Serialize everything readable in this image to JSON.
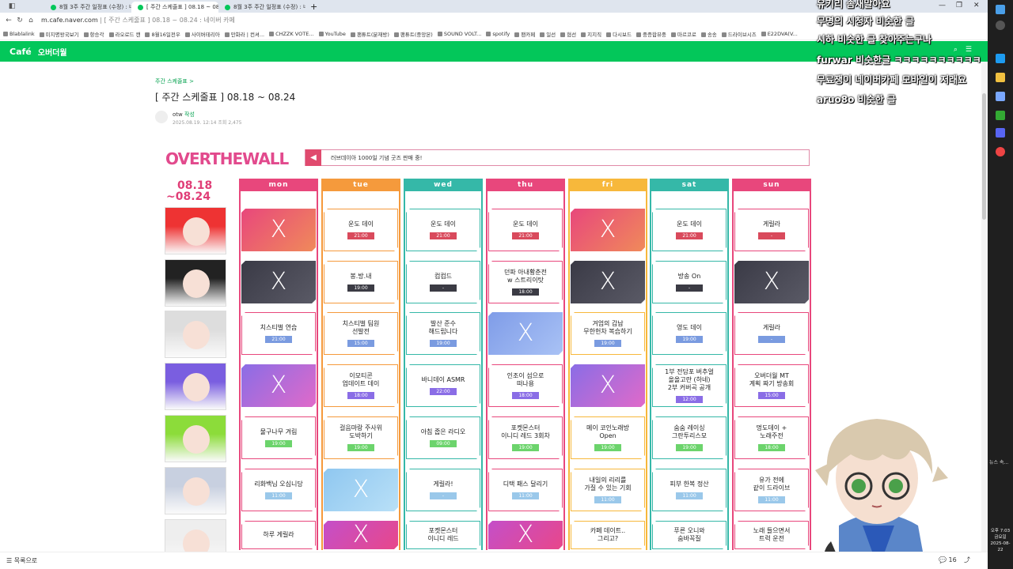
{
  "tabs": [
    {
      "label": "8월 3주 주간 일정표 (수정) : 네"
    },
    {
      "label": "[ 주간 스케줄표 ] 08.18 ~ 08.24"
    },
    {
      "label": "8월 3주 주간 일정표 (수정) : 네이"
    }
  ],
  "address": {
    "host": "m.cafe.naver.com",
    "path": "| [ 주간 스케줄표 ] 08.18 ~ 08.24 : 네이버 카페"
  },
  "bookmarks": [
    "Blablalink",
    "미지명왕국보기",
    "항승각",
    "라오로드 캔",
    "8월16일전우",
    "사이버테리아",
    "만화라 | 컨셔...",
    "CHZZK VOTE...",
    "YouTube",
    "팬튜트(분재방)",
    "팬튜트(중앙본)",
    "SOUND VOLT...",
    "spotify",
    "팬카페",
    "일선",
    "협선",
    "지지직",
    "다시보드",
    "중증합뷰중",
    "마르코로",
    "송송",
    "드라이브시즈",
    "E22DVA(V..."
  ],
  "cafe": {
    "logo": "Café",
    "nick": "오버더월"
  },
  "post": {
    "board": "주간 스케줄표 >",
    "title": "[ 주간 스케줄표 ] 08.18 ~ 08.24",
    "author": "otw",
    "author_badge": "작성",
    "meta": "2025.08.19. 12:14  조회 2,475"
  },
  "banner": {
    "logo": "OVERTHEWALL",
    "dates_top": "08.18",
    "dates_bottom": "~08.24",
    "notice": "러브데이아 1000일 기념 굿즈 판매 중!"
  },
  "days": [
    {
      "name": "mon",
      "color": "#e8477c"
    },
    {
      "name": "tue",
      "color": "#f59a3c"
    },
    {
      "name": "wed",
      "color": "#35b8a8"
    },
    {
      "name": "thu",
      "color": "#e8477c"
    },
    {
      "name": "fri",
      "color": "#f7b83b"
    },
    {
      "name": "sat",
      "color": "#35b8a8"
    },
    {
      "name": "sun",
      "color": "#e8477c"
    }
  ],
  "rows": [
    [
      {
        "x": true,
        "g": "pink"
      },
      {
        "t": "운도 데이",
        "tm": "21:00"
      },
      {
        "t": "운도 데이",
        "tm": "21:00"
      },
      {
        "t": "운도 데이",
        "tm": "21:00"
      },
      {
        "x": true,
        "g": "pink"
      },
      {
        "t": "운도 데이",
        "tm": "21:00"
      },
      {
        "t": "게릴라",
        "tm": "-"
      }
    ],
    [
      {
        "x": true,
        "g": "dark"
      },
      {
        "t": "봉.방.내",
        "tm": "19:00"
      },
      {
        "t": "컴컴드",
        "tm": "-"
      },
      {
        "t": "던파 아내황춘전\nw 스트리이탓",
        "tm": "18:00"
      },
      {
        "x": true,
        "g": "dark"
      },
      {
        "t": "방송 On",
        "tm": "-"
      },
      {
        "x": true,
        "g": "dark"
      }
    ],
    [
      {
        "t": "치스티벌 연습",
        "tm": "21:00"
      },
      {
        "t": "치스티벌 팀원\n선발전",
        "tm": "15:00"
      },
      {
        "t": "발산 준수\n해드립니다",
        "tm": "19:00"
      },
      {
        "x": true,
        "g": "blue"
      },
      {
        "t": "겨엄의 갑납\n무한헌차 복습하기",
        "tm": "19:00"
      },
      {
        "t": "영도 데이",
        "tm": "19:00"
      },
      {
        "t": "게릴라",
        "tm": "-"
      }
    ],
    [
      {
        "x": true,
        "g": "purple"
      },
      {
        "t": "이모티콘\n업데이트 데이",
        "tm": "18:00"
      },
      {
        "t": "바니데이 ASMR",
        "tm": "22:00"
      },
      {
        "t": "인조이 섬으로\n떠나용",
        "tm": "18:00"
      },
      {
        "x": true,
        "g": "purple"
      },
      {
        "t": "1부 전담포 버추얼\n올올고란 (하네)\n2부 커버곡 공개",
        "tm": "12:00"
      },
      {
        "t": "오버더월 MT\n계획 짜기 방송회",
        "tm": "15:00"
      }
    ],
    [
      {
        "t": "물구나무 겨림",
        "tm": "19:00"
      },
      {
        "t": "걸음마랑 주사위\n도박하기",
        "tm": "19:00"
      },
      {
        "t": "아침 줍은 라디오",
        "tm": "09:00"
      },
      {
        "t": "포켓몬스터\n이니디 레드 3회차",
        "tm": "19:00"
      },
      {
        "t": "메이 코인노래방\nOpen",
        "tm": "19:00"
      },
      {
        "t": "숨숨 레이싱\n그란투리스모",
        "tm": "19:00"
      },
      {
        "t": "멍도데이 +\n노래주전",
        "tm": "18:00"
      }
    ],
    [
      {
        "t": "리화백님 오심니당",
        "tm": "11:00"
      },
      {
        "x": true,
        "g": "sky"
      },
      {
        "t": "게릴라!",
        "tm": "-"
      },
      {
        "t": "디택 패스 달리기",
        "tm": "11:00"
      },
      {
        "t": "내일의 리리를\n가질 수 있는 기회",
        "tm": "11:00"
      },
      {
        "t": "피부 한복 정산",
        "tm": "11:00"
      },
      {
        "t": "유가 전에\n같이 드라이브",
        "tm": "11:00"
      }
    ],
    [
      {
        "t": "하루 게릴라",
        "tm": ""
      },
      {
        "x": true,
        "g": "magenta"
      },
      {
        "t": "포켓몬스터\n이니디 레드",
        "tm": ""
      },
      {
        "x": true,
        "g": "magenta"
      },
      {
        "t": "카페 데이트..\n그리고?",
        "tm": ""
      },
      {
        "t": "푸른 오니와\n숨바꼭질",
        "tm": ""
      },
      {
        "t": "노래 들으면서\n트럭 운전",
        "tm": ""
      }
    ]
  ],
  "chat": [
    {
      "n": "유키리",
      "m": "솜새말아요"
    },
    {
      "n": "무명의 시청자",
      "m": "비슷한 글"
    },
    {
      "n": "시하",
      "m": "비슷한 글 찾아주는구나"
    },
    {
      "n": "furwar",
      "m": "비슷한글 ㅋㅋㅋㅋㅋㅋㅋㅋㅋㅋ"
    },
    {
      "n": "무료쟁이",
      "m": "네이버카페 모바일이 저래요"
    },
    {
      "n": "aruo8o",
      "m": "비슷한 글"
    }
  ],
  "bottom": {
    "left": "목록으로",
    "comments": "16"
  },
  "clock": {
    "time": "오후 7:03",
    "day": "금요일",
    "date": "2025-08-22"
  },
  "side_text": "뉴스 속..."
}
